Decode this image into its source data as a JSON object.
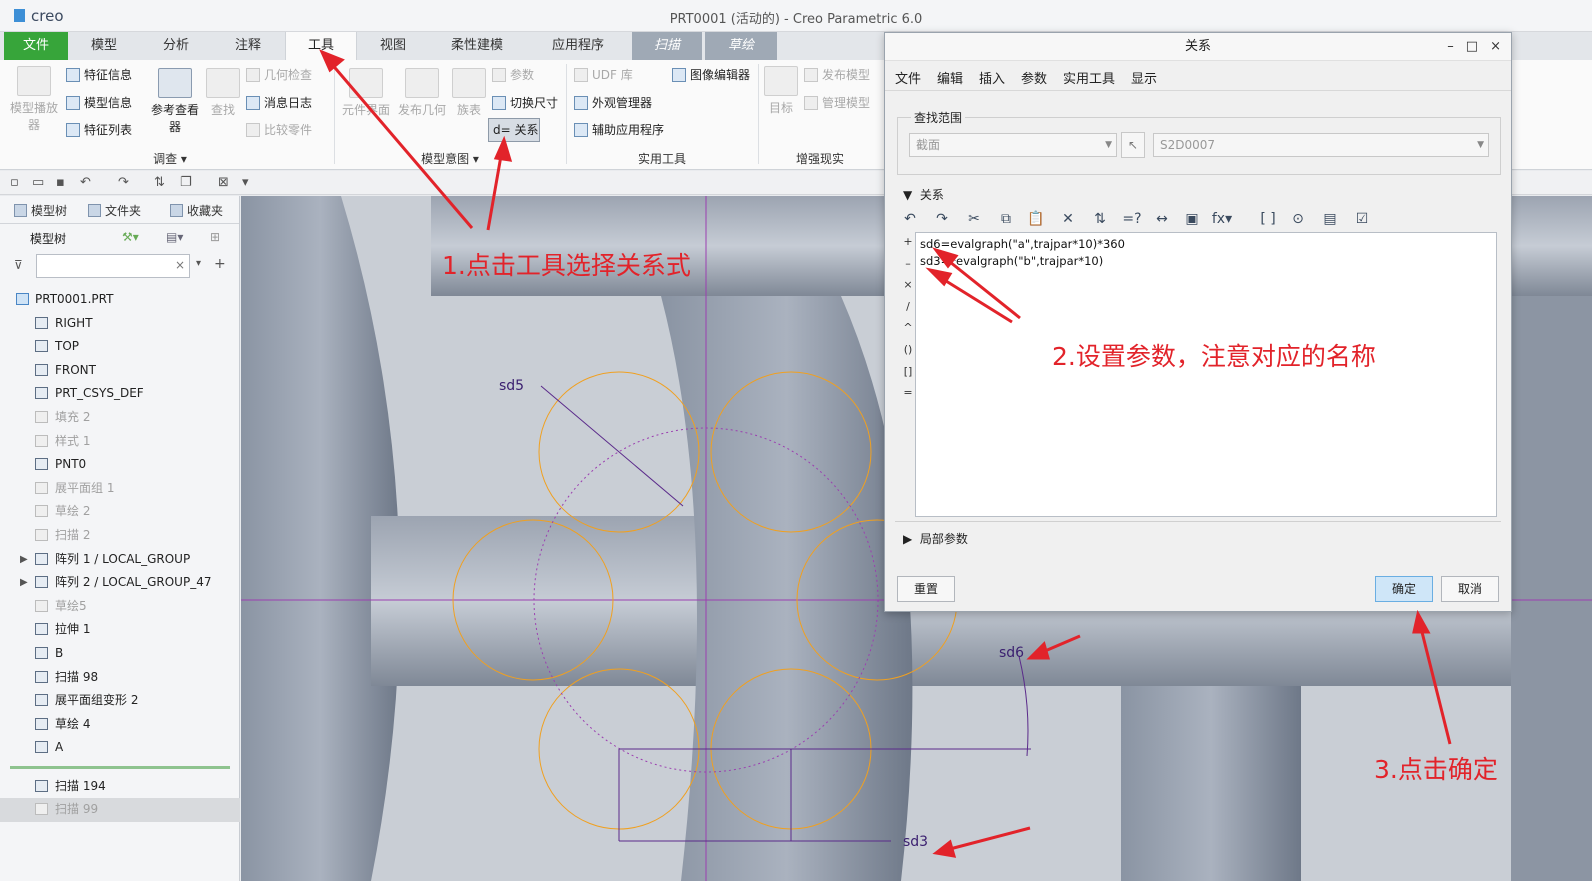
{
  "app": {
    "brand": "creo",
    "window_title": "PRT0001 (活动的) - Creo Parametric 6.0"
  },
  "ribbon_tabs": [
    "文件",
    "模型",
    "分析",
    "注释",
    "工具",
    "视图",
    "柔性建模",
    "应用程序",
    "扫描",
    "草绘"
  ],
  "ribbon": {
    "model_player": "模型播放器",
    "feature_info": "特征信息",
    "model_info": "模型信息",
    "feature_list": "特征列表",
    "ref_viewer": "参考查看器",
    "find": "查找",
    "geom_check": "几何检查",
    "message_log": "消息日志",
    "compare_parts": "比较零件",
    "group_investigate": "调查",
    "component_interface": "元件界面",
    "publish_geom": "发布几何",
    "family_table": "族表",
    "parameters": "参数",
    "switch_dims": "切换尺寸",
    "relations": "关系",
    "group_model_intent": "模型意图",
    "udf_lib": "UDF 库",
    "appearance_mgr": "外观管理器",
    "aux_apps": "辅助应用程序",
    "image_editor": "图像编辑器",
    "group_utilities": "实用工具",
    "target": "目标",
    "publish_model": "发布模型",
    "manage_model": "管理模型",
    "group_augmented": "增强现实"
  },
  "left_panel": {
    "tabs": [
      "模型树",
      "文件夹",
      "收藏夹"
    ],
    "tree_header": "模型树",
    "filter_placeholder": "",
    "items": [
      {
        "label": "PRT0001.PRT",
        "state": "root"
      },
      {
        "label": "RIGHT",
        "state": "normal"
      },
      {
        "label": "TOP",
        "state": "normal"
      },
      {
        "label": "FRONT",
        "state": "normal"
      },
      {
        "label": "PRT_CSYS_DEF",
        "state": "normal"
      },
      {
        "label": "填充 2",
        "state": "dim"
      },
      {
        "label": "样式 1",
        "state": "dim"
      },
      {
        "label": "PNT0",
        "state": "normal"
      },
      {
        "label": "展平面组 1",
        "state": "dim"
      },
      {
        "label": "草绘 2",
        "state": "dim"
      },
      {
        "label": "扫描 2",
        "state": "dim"
      },
      {
        "label": "阵列 1 / LOCAL_GROUP",
        "state": "group"
      },
      {
        "label": "阵列 2 / LOCAL_GROUP_47",
        "state": "group"
      },
      {
        "label": "草绘5",
        "state": "dim"
      },
      {
        "label": "拉伸 1",
        "state": "normal"
      },
      {
        "label": "B",
        "state": "normal"
      },
      {
        "label": "扫描 98",
        "state": "normal"
      },
      {
        "label": "展平面组变形 2",
        "state": "normal"
      },
      {
        "label": "草绘 4",
        "state": "normal"
      },
      {
        "label": "A",
        "state": "normal"
      }
    ],
    "after_items": [
      {
        "label": "扫描 194",
        "state": "normal"
      },
      {
        "label": "扫描 99",
        "state": "selected"
      }
    ]
  },
  "dialog": {
    "title": "关系",
    "menu": [
      "文件",
      "编辑",
      "插入",
      "参数",
      "实用工具",
      "显示"
    ],
    "scope_label": "查找范围",
    "scope_type": "截面",
    "scope_item": "S2D0007",
    "relations_label": "关系",
    "operators": [
      "+",
      "–",
      "×",
      "/",
      "^",
      "()",
      "[]",
      "="
    ],
    "relations_text": [
      "sd6=evalgraph(\"a\",trajpar*10)*360",
      "sd3=​​*evalgraph(\"b\",trajpar*10)"
    ],
    "local_params_label": "局部参数",
    "reset_button": "重置",
    "ok_button": "确定",
    "cancel_button": "取消"
  },
  "sketch_dims": {
    "sd5": "sd5",
    "sd6": "sd6",
    "sd3": "sd3",
    "unit": "1"
  },
  "annotations": {
    "step1": "1.点击工具选择关系式",
    "step2": "2.设置参数，注意对应的名称",
    "step3": "3.点击确定"
  },
  "colors": {
    "file_tab": "#37a53a",
    "annotation": "#e2232a",
    "circle": "#f0a020",
    "sketch_line": "#7b3ea0"
  }
}
